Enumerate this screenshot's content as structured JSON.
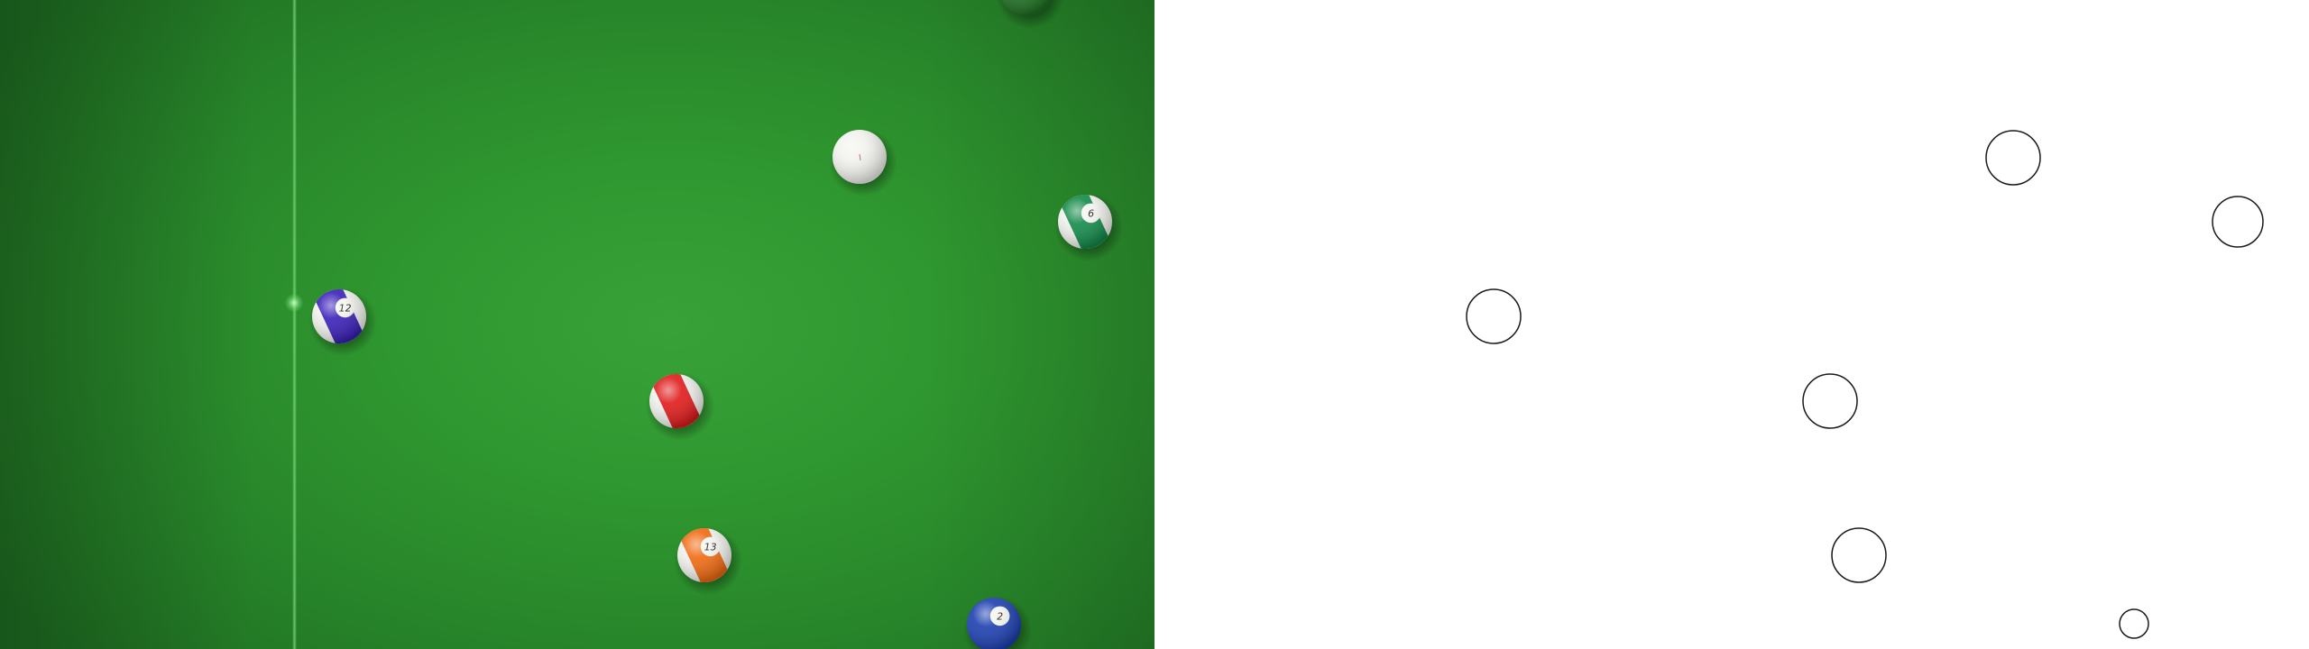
{
  "scene": {
    "table_color": "#2f972f",
    "overlay_background": "#ffffff",
    "outline_color": "#1a1a1a"
  },
  "balls": [
    {
      "id": "partial-top",
      "number": "",
      "kind": "solid",
      "color": "#1f6f22"
    },
    {
      "id": "cue-ball",
      "number": "",
      "kind": "cue",
      "color": "#f2f2ee"
    },
    {
      "id": "ball-6",
      "number": "6",
      "kind": "stripe",
      "color": "#138a4a"
    },
    {
      "id": "ball-12",
      "number": "12",
      "kind": "stripe",
      "color": "#3b1fb8"
    },
    {
      "id": "ball-3",
      "number": "",
      "kind": "stripe",
      "color": "#e01b1b"
    },
    {
      "id": "ball-13",
      "number": "13",
      "kind": "stripe",
      "color": "#f06a12"
    },
    {
      "id": "ball-2",
      "number": "2",
      "kind": "solid",
      "color": "#1d3fb0"
    }
  ],
  "overlay_circles": [
    {
      "id": "circle-cue-ball"
    },
    {
      "id": "circle-ball-6"
    },
    {
      "id": "circle-ball-12"
    },
    {
      "id": "circle-ball-3"
    },
    {
      "id": "circle-ball-13"
    },
    {
      "id": "circle-ball-2"
    }
  ]
}
